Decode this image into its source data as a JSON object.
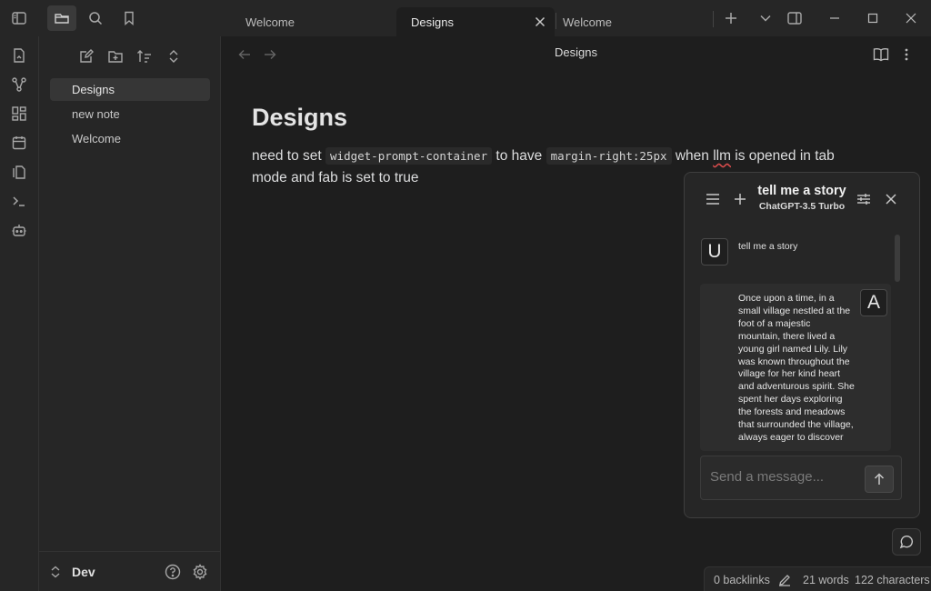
{
  "titlebar": {
    "tabs": [
      {
        "label": "Welcome",
        "active": false
      },
      {
        "label": "Designs",
        "active": true
      },
      {
        "label": "Welcome",
        "active": false
      }
    ]
  },
  "sidebar": {
    "files": [
      {
        "label": "Designs",
        "active": true
      },
      {
        "label": "new note",
        "active": false
      },
      {
        "label": "Welcome",
        "active": false
      }
    ],
    "vault_name": "Dev"
  },
  "view": {
    "title": "Designs"
  },
  "note": {
    "heading": "Designs",
    "text_1": "need to set ",
    "code_1": "widget-prompt-container",
    "text_2": " to have ",
    "code_2": "margin-right:25px",
    "text_3": " when ",
    "misspelled": "llm",
    "text_4": " is opened in tab mode and fab is set to true"
  },
  "chat": {
    "title": "tell me a story",
    "model": "ChatGPT-3.5 Turbo",
    "user_avatar": "U",
    "assistant_avatar": "A",
    "user_message": "tell me a story",
    "assistant_message": "Once upon a time, in a small village nestled at the foot of a majestic mountain, there lived a young girl named Lily. Lily was known throughout the village for her kind heart and adventurous spirit. She spent her days exploring the forests and meadows that surrounded the village, always eager to discover",
    "input_placeholder": "Send a message..."
  },
  "status": {
    "backlinks": "0 backlinks",
    "words": "21 words",
    "characters": "122 characters"
  },
  "colors": {
    "background": "#1e1e1e",
    "panel": "#262626",
    "active_file": "#363636",
    "spellcheck": "#d94c4c"
  }
}
